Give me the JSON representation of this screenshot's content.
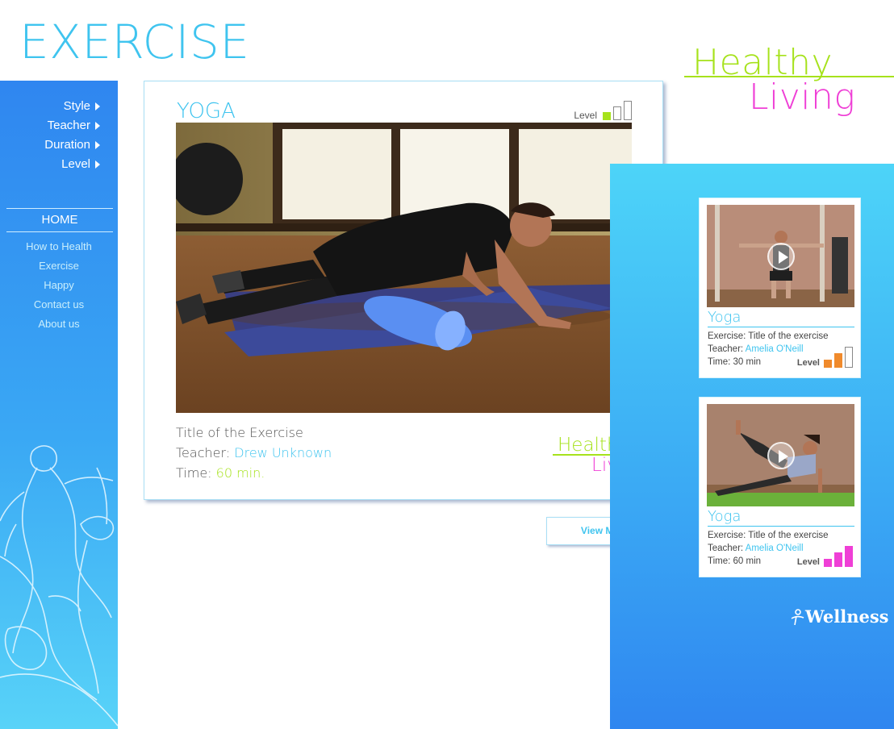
{
  "header": {
    "title": "EXERCISE"
  },
  "brand": {
    "healthy": "Healthy",
    "living": "Living",
    "lime": "#a6e21c",
    "pink": "#ef3fd6",
    "teal": "#3fc4ef"
  },
  "sidebar": {
    "filters": [
      {
        "label": "Style"
      },
      {
        "label": "Teacher"
      },
      {
        "label": "Duration"
      },
      {
        "label": "Level"
      }
    ],
    "home_label": "HOME",
    "nav": [
      {
        "label": "How to Health"
      },
      {
        "label": "Exercise"
      },
      {
        "label": "Happy"
      },
      {
        "label": "Contact us"
      },
      {
        "label": "About us"
      }
    ]
  },
  "featured": {
    "title": "YOGA",
    "level_label": "Level",
    "level_value": 1,
    "level_max": 3,
    "exercise_title": "Title of the Exercise",
    "teacher_label": "Teacher:",
    "teacher_name": "Drew Unknown",
    "time_label": "Time:",
    "time_value": "60 min."
  },
  "view_more_label": "View More",
  "videos": [
    {
      "title": "Yoga",
      "exercise_label": "Exercise:",
      "exercise_value": "Title of the exercise",
      "teacher_label": "Teacher:",
      "teacher_name": "Amelia O'Neill",
      "time_label": "Time:",
      "time_value": "30 min",
      "level_label": "Level",
      "level_value": 2,
      "level_max": 3,
      "level_color": "#f08a2c"
    },
    {
      "title": "Yoga",
      "exercise_label": "Exercise:",
      "exercise_value": "Title of the exercise",
      "teacher_label": "Teacher:",
      "teacher_name": "Amelia O'Neill",
      "time_label": "Time:",
      "time_value": "60 min",
      "level_label": "Level",
      "level_value": 3,
      "level_max": 3,
      "level_color": "#ef3fd6"
    }
  ],
  "footer_brand": {
    "name": "Wellness"
  }
}
